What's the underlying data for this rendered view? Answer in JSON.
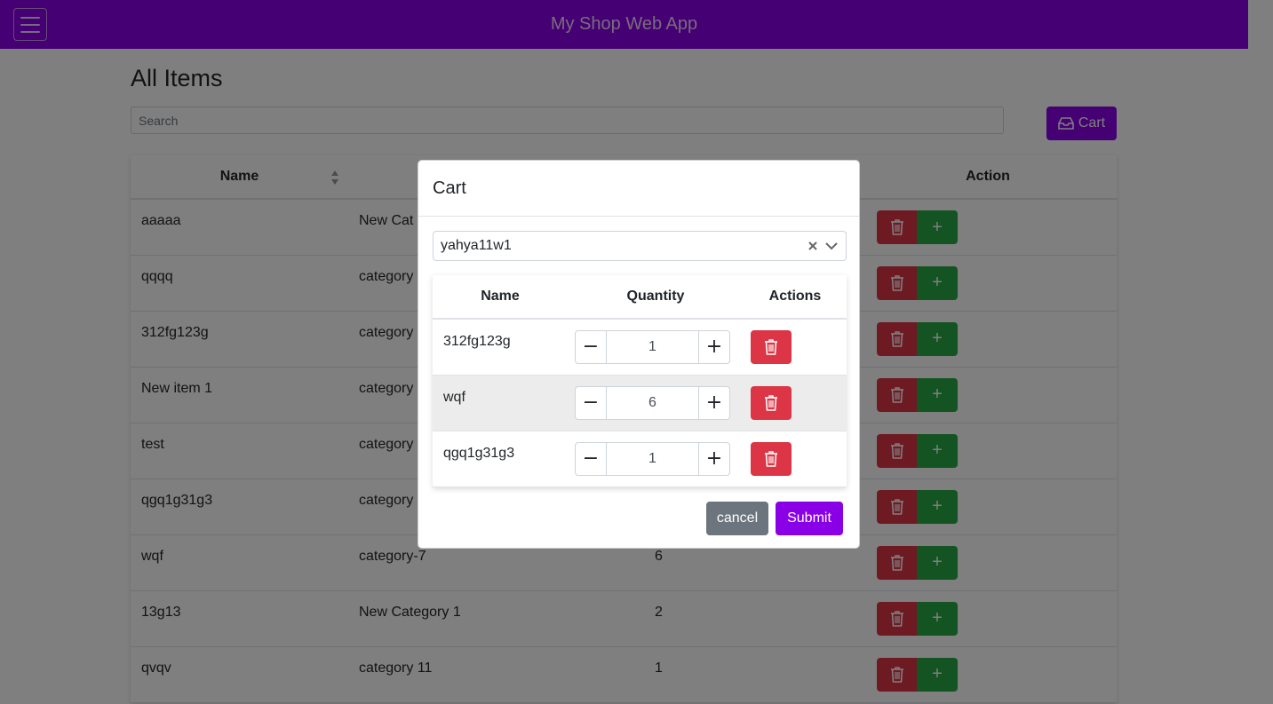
{
  "navbar": {
    "title": "My Shop Web App"
  },
  "page": {
    "title": "All Items",
    "search_placeholder": "Search",
    "cart_button_label": "Cart"
  },
  "items_table": {
    "columns": [
      "Name",
      "",
      "",
      "Action"
    ],
    "rows": [
      {
        "name": "aaaaa",
        "category": "New Cat",
        "quantity": ""
      },
      {
        "name": "qqqq",
        "category": "category",
        "quantity": ""
      },
      {
        "name": "312fg123g",
        "category": "category",
        "quantity": ""
      },
      {
        "name": "New item 1",
        "category": "category",
        "quantity": ""
      },
      {
        "name": "test",
        "category": "category",
        "quantity": ""
      },
      {
        "name": "qgq1g31g3",
        "category": "category",
        "quantity": ""
      },
      {
        "name": "wqf",
        "category": "category-7",
        "quantity": "6"
      },
      {
        "name": "13g13",
        "category": "New Category 1",
        "quantity": "2"
      },
      {
        "name": "qvqv",
        "category": "category 11",
        "quantity": "1"
      }
    ]
  },
  "cart_modal": {
    "title": "Cart",
    "selected_user": "yahya11w1",
    "columns": [
      "Name",
      "Quantity",
      "Actions"
    ],
    "items": [
      {
        "name": "312fg123g",
        "quantity": "1"
      },
      {
        "name": "wqf",
        "quantity": "6"
      },
      {
        "name": "qgq1g31g3",
        "quantity": "1"
      }
    ],
    "cancel_label": "cancel",
    "submit_label": "Submit"
  },
  "colors": {
    "brand": "#8a00e6",
    "danger": "#dc3545",
    "success": "#28a745",
    "secondary": "#6c757d"
  }
}
